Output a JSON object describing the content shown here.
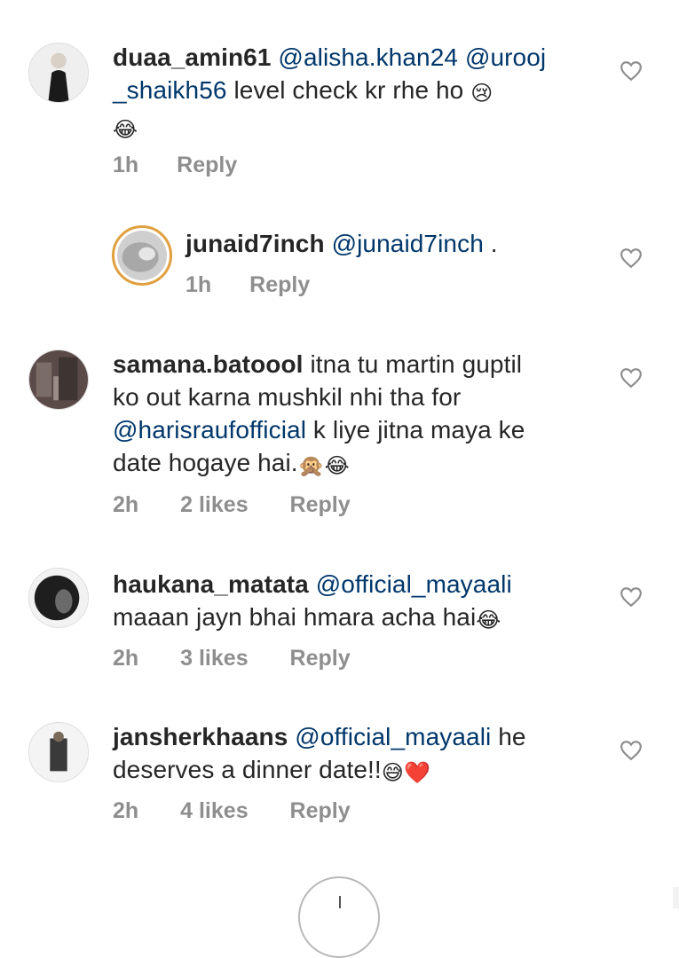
{
  "comments": [
    {
      "username": "duaa_amin61",
      "mention1": "@alisha.khan24",
      "mention2a": "@urooj",
      "mention2b": "_shaikh56",
      "text": "level check kr rhe ho",
      "emoji1": "😢",
      "emoji2": "😂",
      "time": "1h",
      "reply_label": "Reply"
    },
    {
      "username": "junaid7inch",
      "mention1": "@junaid7inch",
      "text": ".",
      "time": "1h",
      "reply_label": "Reply"
    },
    {
      "username": "samana.batoool",
      "text1": "itna tu martin guptil",
      "text2": "ko out karna mushkil nhi tha for",
      "mention1": "@harisraufofficial",
      "text3": "k liye jitna maya ke",
      "text4": "date hogaye hai.",
      "emoji1": "🙊",
      "emoji2": "😂",
      "time": "2h",
      "likes": "2 likes",
      "reply_label": "Reply"
    },
    {
      "username": "haukana_matata",
      "mention1": "@official_mayaali",
      "text1": "maaan jayn bhai hmara acha hai",
      "emoji1": "😂",
      "time": "2h",
      "likes": "3 likes",
      "reply_label": "Reply"
    },
    {
      "username": "jansherkhaans",
      "mention1": "@official_mayaali",
      "text1": "he",
      "text2": "deserves a dinner date!!",
      "emoji1": "😅",
      "emoji2": "❤️",
      "time": "2h",
      "likes": "4 likes",
      "reply_label": "Reply"
    }
  ],
  "icons": {
    "like": "heart-outline-icon",
    "load_more": "plus-circle-icon"
  },
  "colors": {
    "text": "#262626",
    "mention": "#00376b",
    "meta": "#8e8e8e",
    "story_ring": "#e0a040"
  }
}
